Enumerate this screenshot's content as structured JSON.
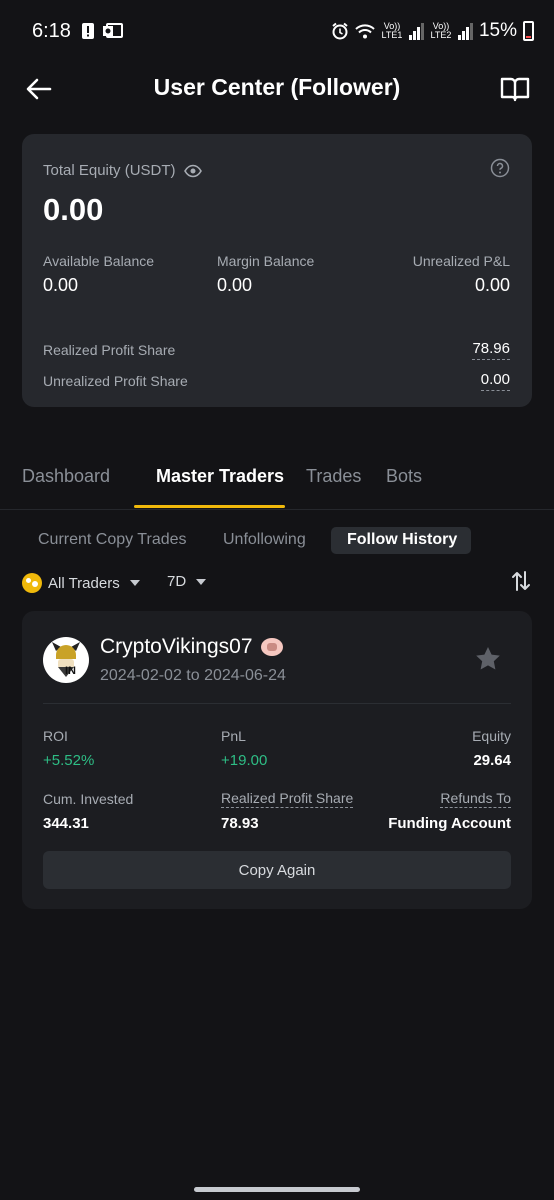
{
  "status_bar": {
    "time": "6:18",
    "sim1": "Vo)) LTE1",
    "sim2": "Vo)) LTE2",
    "battery": "15%"
  },
  "header": {
    "title": "User Center (Follower)"
  },
  "equity": {
    "label": "Total Equity (USDT)",
    "value": "0.00",
    "available_label": "Available Balance",
    "available_value": "0.00",
    "margin_label": "Margin Balance",
    "margin_value": "0.00",
    "unrealized_label": "Unrealized P&L",
    "unrealized_value": "0.00",
    "realized_share_label": "Realized Profit Share",
    "realized_share_value": "78.96",
    "unrealized_share_label": "Unrealized Profit Share",
    "unrealized_share_value": "0.00"
  },
  "tabs": [
    {
      "label": "Dashboard",
      "active": false
    },
    {
      "label": "Master Traders",
      "active": true
    },
    {
      "label": "Trades",
      "active": false
    },
    {
      "label": "Bots",
      "active": false
    }
  ],
  "subtabs": [
    {
      "label": "Current Copy Trades"
    },
    {
      "label": "Unfollowing"
    },
    {
      "label": "Follow History",
      "active": true
    }
  ],
  "filters": {
    "traders": "All Traders",
    "period": "7D"
  },
  "trader": {
    "name": "CryptoVikings07",
    "avatar_badge": "IN",
    "dates": "2024-02-02 to 2024-06-24",
    "roi_label": "ROI",
    "roi_value": "+5.52%",
    "pnl_label": "PnL",
    "pnl_value": "+19.00",
    "equity_label": "Equity",
    "equity_value": "29.64",
    "invested_label": "Cum. Invested",
    "invested_value": "344.31",
    "profit_share_label": "Realized Profit Share",
    "profit_share_value": "78.93",
    "refunds_label": "Refunds To",
    "refunds_value": "Funding Account",
    "copy_button": "Copy Again"
  },
  "colors": {
    "accent": "#f0b90b",
    "positive": "#2ebd85",
    "background": "#131316",
    "card": "#26282d"
  }
}
